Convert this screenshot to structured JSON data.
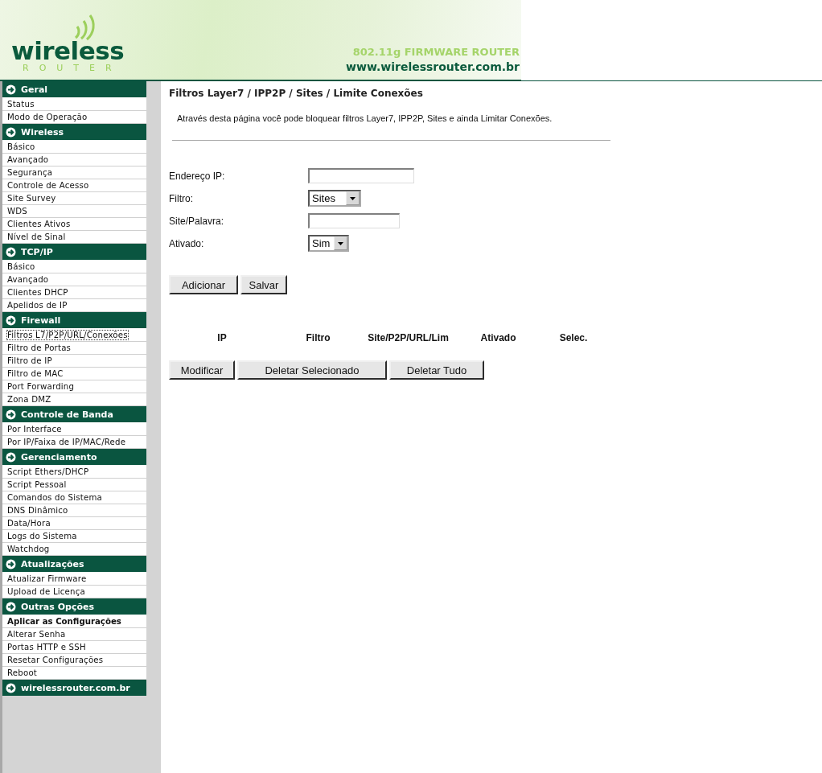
{
  "header": {
    "logo_word": "wireless",
    "logo_sub": "ROUTER",
    "tagline": "802.11g FIRMWARE ROUTER",
    "url": "www.wirelessrouter.com.br"
  },
  "sidebar": {
    "sections": [
      {
        "title": "Geral",
        "items": [
          {
            "label": "Status",
            "selected": false,
            "bold": false
          },
          {
            "label": "Modo de Operação",
            "selected": false,
            "bold": false
          }
        ]
      },
      {
        "title": "Wireless",
        "items": [
          {
            "label": "Básico",
            "selected": false,
            "bold": false
          },
          {
            "label": "Avançado",
            "selected": false,
            "bold": false
          },
          {
            "label": "Segurança",
            "selected": false,
            "bold": false
          },
          {
            "label": "Controle de Acesso",
            "selected": false,
            "bold": false
          },
          {
            "label": "Site Survey",
            "selected": false,
            "bold": false
          },
          {
            "label": "WDS",
            "selected": false,
            "bold": false
          },
          {
            "label": "Clientes Ativos",
            "selected": false,
            "bold": false
          },
          {
            "label": "Nível de Sinal",
            "selected": false,
            "bold": false
          }
        ]
      },
      {
        "title": "TCP/IP",
        "items": [
          {
            "label": "Básico",
            "selected": false,
            "bold": false
          },
          {
            "label": "Avançado",
            "selected": false,
            "bold": false
          },
          {
            "label": "Clientes DHCP",
            "selected": false,
            "bold": false
          },
          {
            "label": "Apelidos de IP",
            "selected": false,
            "bold": false
          }
        ]
      },
      {
        "title": "Firewall",
        "items": [
          {
            "label": "Filtros L7/P2P/URL/Conexões",
            "selected": true,
            "bold": false
          },
          {
            "label": "Filtro de Portas",
            "selected": false,
            "bold": false
          },
          {
            "label": "Filtro de IP",
            "selected": false,
            "bold": false
          },
          {
            "label": "Filtro de MAC",
            "selected": false,
            "bold": false
          },
          {
            "label": "Port Forwarding",
            "selected": false,
            "bold": false
          },
          {
            "label": "Zona DMZ",
            "selected": false,
            "bold": false
          }
        ]
      },
      {
        "title": "Controle de Banda",
        "items": [
          {
            "label": "Por Interface",
            "selected": false,
            "bold": false
          },
          {
            "label": "Por IP/Faixa de IP/MAC/Rede",
            "selected": false,
            "bold": false
          }
        ]
      },
      {
        "title": "Gerenciamento",
        "items": [
          {
            "label": "Script Ethers/DHCP",
            "selected": false,
            "bold": false
          },
          {
            "label": "Script Pessoal",
            "selected": false,
            "bold": false
          },
          {
            "label": "Comandos do Sistema",
            "selected": false,
            "bold": false
          },
          {
            "label": "DNS Dinâmico",
            "selected": false,
            "bold": false
          },
          {
            "label": "Data/Hora",
            "selected": false,
            "bold": false
          },
          {
            "label": "Logs do Sistema",
            "selected": false,
            "bold": false
          },
          {
            "label": "Watchdog",
            "selected": false,
            "bold": false
          }
        ]
      },
      {
        "title": "Atualizações",
        "items": [
          {
            "label": "Atualizar Firmware",
            "selected": false,
            "bold": false
          },
          {
            "label": "Upload de Licença",
            "selected": false,
            "bold": false
          }
        ]
      },
      {
        "title": "Outras Opções",
        "items": [
          {
            "label": "Aplicar as Configurações",
            "selected": false,
            "bold": true
          },
          {
            "label": "Alterar Senha",
            "selected": false,
            "bold": false
          },
          {
            "label": "Portas HTTP e SSH",
            "selected": false,
            "bold": false
          },
          {
            "label": "Resetar Configurações",
            "selected": false,
            "bold": false
          },
          {
            "label": "Reboot",
            "selected": false,
            "bold": false
          }
        ]
      },
      {
        "title": "wirelessrouter.com.br"
      }
    ]
  },
  "page": {
    "title": "Filtros Layer7 / IPP2P / Sites / Limite Conexões",
    "description": "Através desta página você pode bloquear filtros Layer7, IPP2P, Sites e ainda Limitar Conexões.",
    "form": [
      {
        "kind": "text",
        "label": "Endereço IP:"
      },
      {
        "kind": "select",
        "label": "Filtro:",
        "value": "Sites"
      },
      {
        "kind": "text",
        "label": "Site/Palavra:"
      },
      {
        "kind": "select",
        "label": "Ativado:",
        "value": "Sim"
      }
    ],
    "form_buttons": [
      "Adicionar",
      "Salvar"
    ],
    "table": {
      "columns": [
        "IP",
        "Filtro",
        "Site/P2P/URL/Lim",
        "Ativado",
        "Selec."
      ]
    },
    "table_buttons": [
      "Modificar",
      "Deletar Selecionado",
      "Deletar Tudo"
    ]
  }
}
